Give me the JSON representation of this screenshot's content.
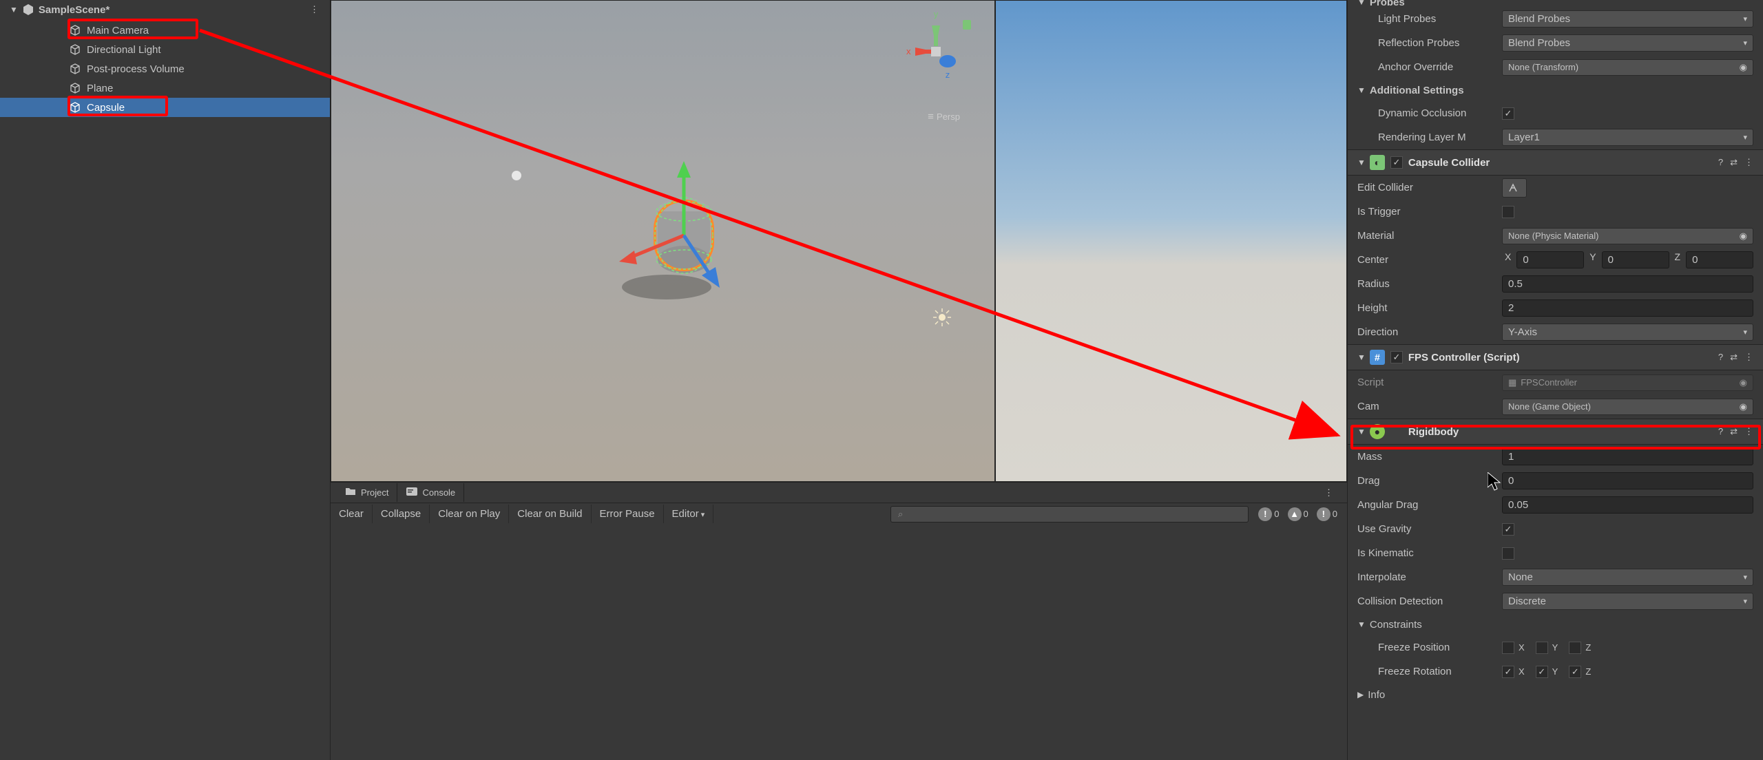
{
  "hierarchy": {
    "scene_name": "SampleScene*",
    "items": [
      {
        "label": "Main Camera"
      },
      {
        "label": "Directional Light"
      },
      {
        "label": "Post-process Volume"
      },
      {
        "label": "Plane"
      },
      {
        "label": "Capsule",
        "selected": true
      }
    ]
  },
  "sceneview": {
    "camera_mode": "Persp",
    "axes": [
      "x",
      "y",
      "z"
    ]
  },
  "tabs_lower": {
    "project": "Project",
    "console": "Console"
  },
  "console": {
    "buttons": [
      "Clear",
      "Collapse",
      "Clear on Play",
      "Clear on Build",
      "Error Pause",
      "Editor"
    ],
    "search_placeholder": "",
    "counts": {
      "info": "0",
      "warn": "0",
      "error": "0"
    }
  },
  "inspector": {
    "probes": {
      "title": "Probes",
      "light_probes_label": "Light Probes",
      "light_probes_value": "Blend Probes",
      "reflection_label": "Reflection Probes",
      "reflection_value": "Blend Probes",
      "anchor_label": "Anchor Override",
      "anchor_value": "None (Transform)"
    },
    "additional": {
      "title": "Additional Settings",
      "dynamic_occ_label": "Dynamic Occlusion",
      "dynamic_occ": true,
      "rendering_label": "Rendering Layer M",
      "rendering_value": "Layer1"
    },
    "collider": {
      "title": "Capsule Collider",
      "edit_label": "Edit Collider",
      "is_trigger_label": "Is Trigger",
      "is_trigger": false,
      "material_label": "Material",
      "material_value": "None (Physic Material)",
      "center_label": "Center",
      "center": {
        "x": "0",
        "y": "0",
        "z": "0"
      },
      "radius_label": "Radius",
      "radius": "0.5",
      "height_label": "Height",
      "height": "2",
      "direction_label": "Direction",
      "direction": "Y-Axis"
    },
    "fps": {
      "title": "FPS Controller (Script)",
      "script_label": "Script",
      "script_value": "FPSController",
      "cam_label": "Cam",
      "cam_value": "None (Game Object)"
    },
    "rigidbody": {
      "title": "Rigidbody",
      "mass_label": "Mass",
      "mass": "1",
      "drag_label": "Drag",
      "drag": "0",
      "angular_label": "Angular Drag",
      "angular": "0.05",
      "gravity_label": "Use Gravity",
      "gravity": true,
      "kinematic_label": "Is Kinematic",
      "kinematic": false,
      "interpolate_label": "Interpolate",
      "interpolate": "None",
      "collision_label": "Collision Detection",
      "collision": "Discrete",
      "constraints_label": "Constraints",
      "freeze_pos_label": "Freeze Position",
      "freeze_pos": {
        "x": false,
        "y": false,
        "z": false
      },
      "freeze_rot_label": "Freeze Rotation",
      "freeze_rot": {
        "x": true,
        "y": true,
        "z": true
      },
      "info_label": "Info"
    }
  },
  "axis_letters": {
    "x": "X",
    "y": "Y",
    "z": "Z"
  }
}
